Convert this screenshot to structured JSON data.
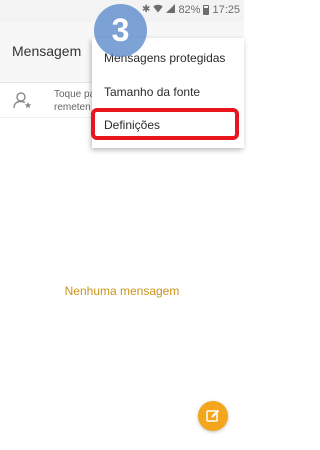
{
  "status_bar": {
    "battery": "82%",
    "time": "17:25",
    "icons": [
      "bluetooth-icon",
      "wifi-icon",
      "signal-icon",
      "battery-icon"
    ]
  },
  "app_bar": {
    "title": "Mensagem"
  },
  "compose": {
    "line1": "Toque pa",
    "line2": "remeten"
  },
  "overflow_menu": {
    "items": [
      {
        "label": "Mensagens protegidas"
      },
      {
        "label": "Tamanho da fonte"
      },
      {
        "label": "Definições"
      }
    ],
    "highlighted_index": 2
  },
  "tutorial": {
    "step_number": "3",
    "highlight_color": "#e8151c",
    "badge_color": "#608dcd"
  },
  "empty_state": {
    "text": "Nenhuma mensagem",
    "color": "#c9931b"
  },
  "fab": {
    "icon": "compose-icon",
    "color": "#f3a51c"
  }
}
